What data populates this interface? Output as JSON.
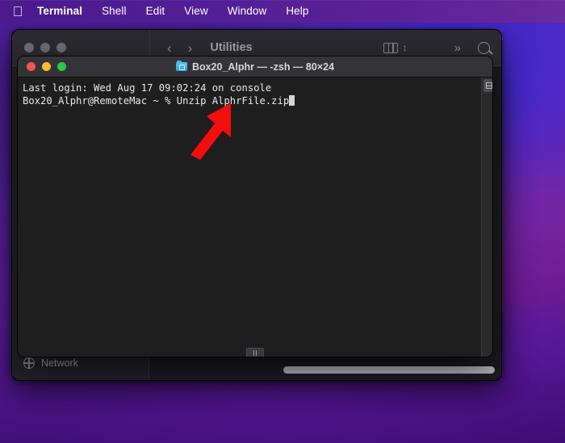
{
  "menubar": {
    "apple_icon": "apple-logo",
    "items": [
      {
        "label": "Terminal",
        "bold": true
      },
      {
        "label": "Shell",
        "bold": false
      },
      {
        "label": "Edit",
        "bold": false
      },
      {
        "label": "View",
        "bold": false
      },
      {
        "label": "Window",
        "bold": false
      },
      {
        "label": "Help",
        "bold": false
      }
    ]
  },
  "finder": {
    "title": "Utilities",
    "nav": {
      "back": "‹",
      "forward": "›"
    },
    "toolbar": {
      "view_icon": "column-view-icon",
      "updown_icon": "⌃⌄",
      "overflow": "»",
      "search_icon": "search-icon"
    },
    "sidebar": {
      "items": [
        {
          "label": "Network",
          "icon": "globe-icon"
        }
      ]
    }
  },
  "terminal": {
    "title": "Box20_Alphr — -zsh — 80×24",
    "folder_icon": "folder-icon",
    "lights": [
      {
        "name": "close",
        "color": "#f2574e"
      },
      {
        "name": "minimize",
        "color": "#fcbd2e"
      },
      {
        "name": "maximize",
        "color": "#2bc840"
      }
    ],
    "lines": [
      "Last login: Wed Aug 17 09:02:24 on console",
      "Box20_Alphr@RemoteMac ~ % Unzip AlphrFile.zip"
    ],
    "prompt_line_index": 1,
    "cursor": "block-cursor"
  },
  "annotation": {
    "arrow": {
      "color": "#f50d0d",
      "direction": "up-right",
      "points_at": "AlphrFile.zip"
    }
  },
  "colors": {
    "desktop_primary": "#5c1b9e",
    "menubar": "#4a1a8e",
    "terminal_bg": "#1e1e1e",
    "terminal_text": "#e8e8e8",
    "finder_chrome": "#2b2a30"
  }
}
